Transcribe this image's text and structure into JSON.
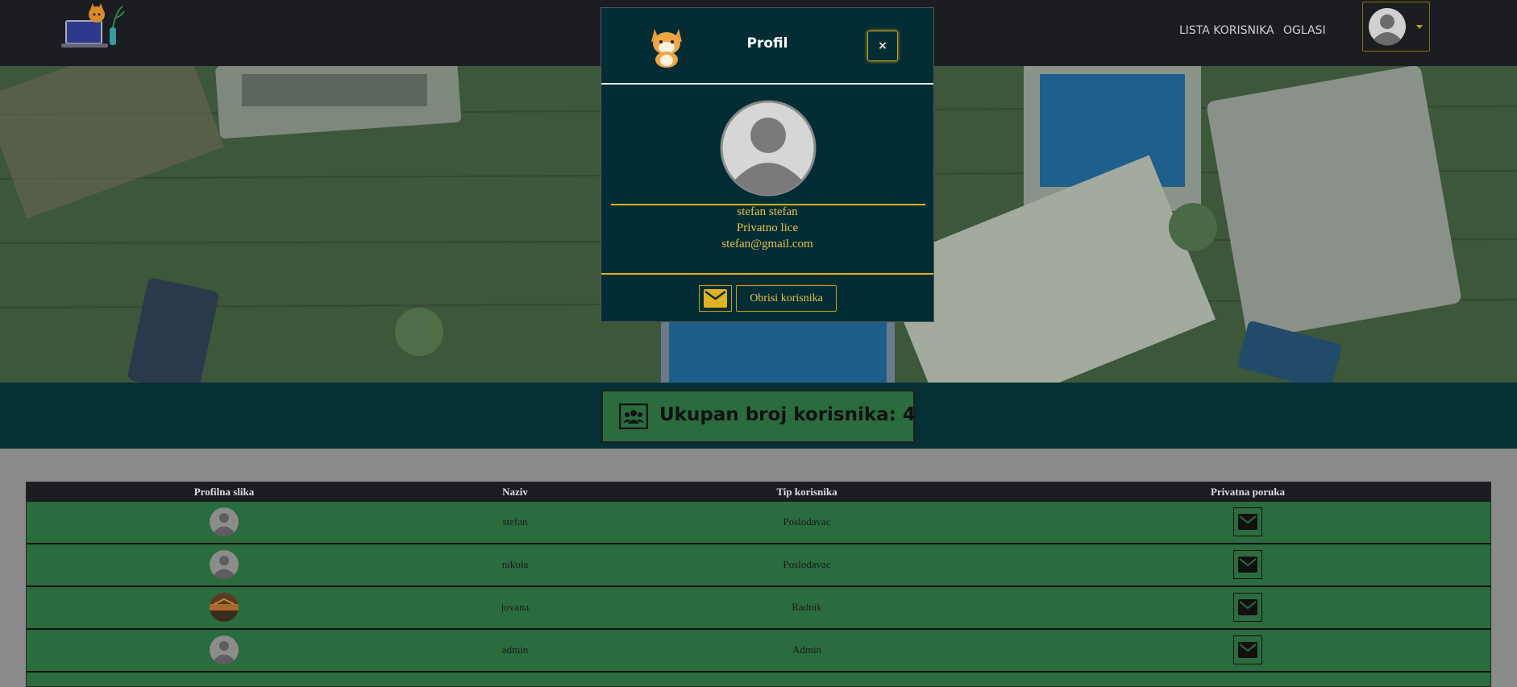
{
  "navbar": {
    "logo_icon": "laptop-cat-logo",
    "links": [
      "LISTA KORISNIKA",
      "OGLASI"
    ],
    "avatar_icon": "user-avatar-icon"
  },
  "counter": {
    "icon": "users-icon",
    "text": "Ukupan broj korisnika: 4"
  },
  "table": {
    "headers": [
      "Profilna slika",
      "Naziv",
      "Tip korisnika",
      "Privatna poruka"
    ],
    "rows": [
      {
        "avatar": "default-avatar",
        "name": "stefan",
        "type": "Poslodavac",
        "message_icon": "envelope-icon"
      },
      {
        "avatar": "default-avatar",
        "name": "nikola",
        "type": "Poslodavac",
        "message_icon": "envelope-icon"
      },
      {
        "avatar": "photo-avatar",
        "name": "jovana",
        "type": "Radnik",
        "message_icon": "envelope-icon"
      },
      {
        "avatar": "default-avatar",
        "name": "admin",
        "type": "Admin",
        "message_icon": "envelope-icon"
      }
    ]
  },
  "modal": {
    "title": "Profil",
    "close_label": "×",
    "header_icon": "cat-icon",
    "full_name": "stefan stefan",
    "user_type": "Privatno lice",
    "email": "stefan@gmail.com",
    "message_icon": "envelope-icon",
    "delete_label": "Obrisi korisnika"
  },
  "colors": {
    "navbar_bg": "#1b1d20",
    "band_bg": "#053035",
    "row_green": "#2b6c3e",
    "modal_bg": "#032d35",
    "accent_gold": "#e0b320"
  }
}
